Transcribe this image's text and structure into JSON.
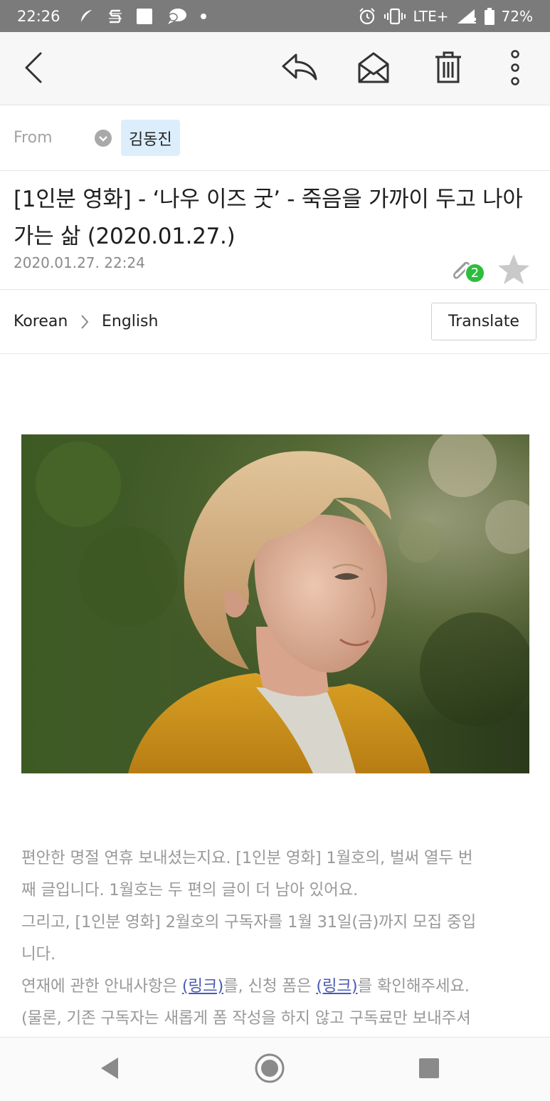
{
  "status_bar": {
    "time": "22:26",
    "network": "LTE+",
    "battery": "72%",
    "left_icons": [
      "feather-icon",
      "s-app-icon",
      "image-icon",
      "chat-bubble-icon",
      "dot-icon"
    ],
    "right_icons": [
      "alarm-icon",
      "vibrate-icon",
      "signal-icon",
      "battery-icon"
    ]
  },
  "toolbar": {
    "icons": [
      "back-arrow-icon",
      "reply-icon",
      "open-envelope-icon",
      "trash-icon",
      "more-vertical-icon"
    ]
  },
  "from": {
    "label": "From",
    "sender": "김동진"
  },
  "message": {
    "subject": "[1인분 영화] - ‘나우 이즈 굿’ - 죽음을 가까이 두고 나아가는 삶 (2020.01.27.)",
    "date": "2020.01.27. 22:24",
    "attachment_count": "2",
    "starred": false
  },
  "translate": {
    "source": "Korean",
    "target": "English",
    "button": "Translate"
  },
  "body": {
    "line1": "편안한 명절 연휴 보내셨는지요. [1인분 영화] 1월호의, 벌써 열두 번",
    "line2": "째 글입니다. 1월호는 두 편의 글이 더 남아 있어요.",
    "line3": "그리고, [1인분 영화] 2월호의 구독자를 1월 31일(금)까지 모집 중입",
    "line4": "니다.",
    "line5_a": "연재에 관한 안내사항은 ",
    "link1": "(링크)",
    "line5_b": "를, 신청 폼은 ",
    "link2": "(링크)",
    "line5_c": "를 확인해주세요.",
    "line6": "(물론, 기존 구독자는 새롭게 폼 작성을 하지 않고 구독료만 보내주셔"
  },
  "nav_bar": {
    "icons": [
      "nav-back-icon",
      "nav-home-icon",
      "nav-recents-icon"
    ]
  },
  "colors": {
    "status_bar": "#7b7b7b",
    "sender_chip": "#dceefc",
    "badge": "#2dbd3e",
    "link": "#4a5bb3",
    "body_text": "#999999"
  }
}
